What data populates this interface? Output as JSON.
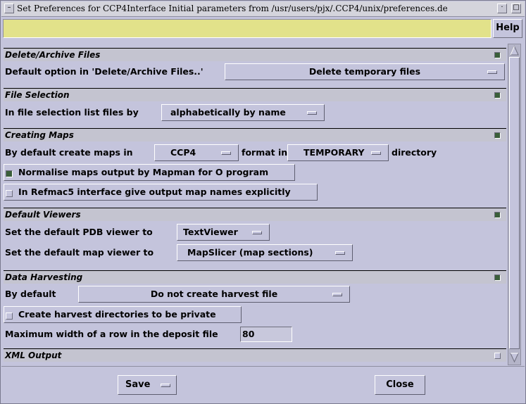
{
  "window": {
    "title": "Set Preferences for CCP4Interface Initial parameters from /usr/users/pjx/.CCP4/unix/preferences.de"
  },
  "toolbar": {
    "message": "",
    "help_label": "Help"
  },
  "sections": {
    "delete_archive": {
      "title": "Delete/Archive Files",
      "expanded": true,
      "default_option_label": "Default option in 'Delete/Archive Files..'",
      "default_option_value": "Delete temporary files"
    },
    "file_selection": {
      "title": "File Selection",
      "expanded": true,
      "list_by_label": "In file selection list files by",
      "list_by_value": "alphabetically by name"
    },
    "creating_maps": {
      "title": "Creating Maps",
      "expanded": true,
      "create_in_label": "By default create maps in",
      "format_value": "CCP4",
      "format_in_label": "format in",
      "directory_value": "TEMPORARY",
      "directory_label": "directory",
      "normalise_label": "Normalise maps output by Mapman for O program",
      "normalise_checked": true,
      "refmac_label": "In Refmac5 interface give output map names explicitly",
      "refmac_checked": false
    },
    "default_viewers": {
      "title": "Default Viewers",
      "expanded": true,
      "pdb_viewer_label": "Set the default PDB viewer to",
      "pdb_viewer_value": "TextViewer",
      "map_viewer_label": "Set the default map viewer to",
      "map_viewer_value": "MapSlicer (map sections)"
    },
    "data_harvesting": {
      "title": "Data Harvesting",
      "expanded": true,
      "by_default_label": "By default",
      "by_default_value": "Do not create harvest file",
      "private_label": "Create harvest directories to be private",
      "private_checked": false,
      "max_width_label": "Maximum width of a row in the deposit file",
      "max_width_value": "80"
    },
    "xml_output": {
      "title": "XML Output",
      "expanded": false
    }
  },
  "footer": {
    "save_label": "Save",
    "close_label": "Close"
  },
  "colors": {
    "background": "#c4c4dc",
    "message_bar": "#e2e28a",
    "toggle_on": "#3a5e3a"
  }
}
